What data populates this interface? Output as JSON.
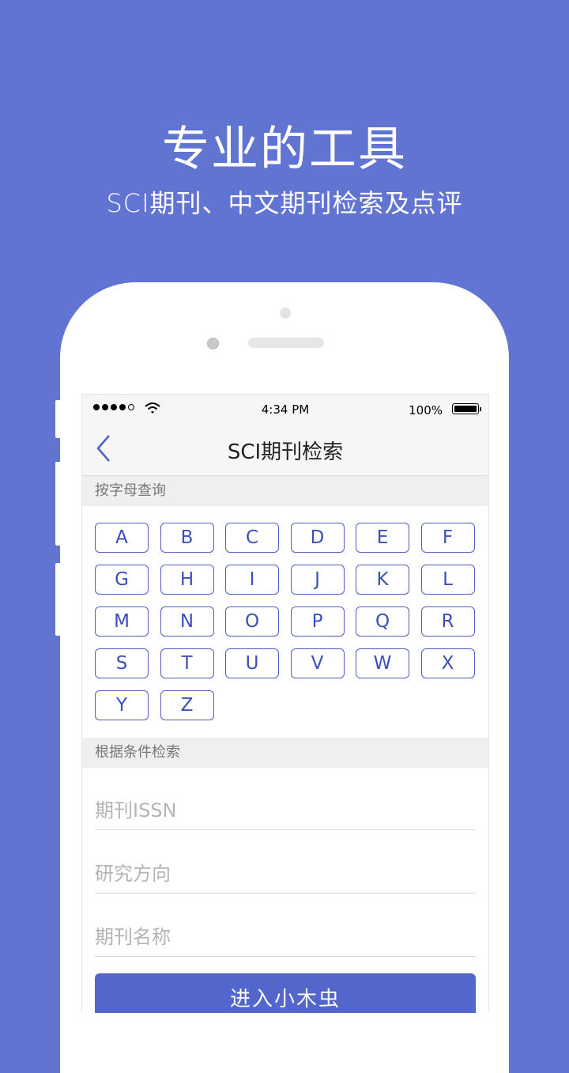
{
  "promo": {
    "headline": "专业的工具",
    "subline": "SCI期刊、中文期刊检索及点评"
  },
  "status_bar": {
    "time": "4:34 PM",
    "battery": "100%",
    "signal_icon": "signal-dots-icon",
    "wifi_icon": "wifi-icon",
    "battery_icon": "battery-icon"
  },
  "nav": {
    "back_icon": "chevron-left-icon",
    "title": "SCI期刊检索"
  },
  "letter_section": {
    "title": "按字母查询",
    "letters": [
      "A",
      "B",
      "C",
      "D",
      "E",
      "F",
      "G",
      "H",
      "I",
      "J",
      "K",
      "L",
      "M",
      "N",
      "O",
      "P",
      "Q",
      "R",
      "S",
      "T",
      "U",
      "V",
      "W",
      "X",
      "Y",
      "Z"
    ]
  },
  "criteria_section": {
    "title": "根据条件检索",
    "issn_placeholder": "期刊ISSN",
    "direction_placeholder": "研究方向",
    "name_placeholder": "期刊名称"
  },
  "enter_button": "进入小木虫",
  "colors": {
    "background": "#6174d2",
    "accent": "#4f5fc4",
    "button": "#5366cc"
  }
}
